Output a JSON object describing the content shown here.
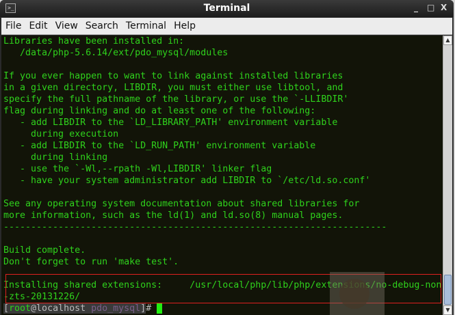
{
  "window": {
    "title": "Terminal",
    "minimize": "_",
    "maximize": "□",
    "close": "X"
  },
  "menu": [
    "File",
    "Edit",
    "View",
    "Search",
    "Terminal",
    "Help"
  ],
  "output": [
    "Libraries have been installed in:",
    "   /data/php-5.6.14/ext/pdo_mysql/modules",
    "",
    "If you ever happen to want to link against installed libraries",
    "in a given directory, LIBDIR, you must either use libtool, and",
    "specify the full pathname of the library, or use the `-LLIBDIR'",
    "flag during linking and do at least one of the following:",
    "   - add LIBDIR to the `LD_LIBRARY_PATH' environment variable",
    "     during execution",
    "   - add LIBDIR to the `LD_RUN_PATH' environment variable",
    "     during linking",
    "   - use the `-Wl,--rpath -Wl,LIBDIR' linker flag",
    "   - have your system administrator add LIBDIR to `/etc/ld.so.conf'",
    "",
    "See any operating system documentation about shared libraries for",
    "more information, such as the ld(1) and ld.so(8) manual pages.",
    "----------------------------------------------------------------------",
    "",
    "Build complete.",
    "Don't forget to run 'make test'.",
    "",
    "Installing shared extensions:     /usr/local/php/lib/php/extensions/no-debug-non",
    "-zts-20131226/"
  ],
  "prompt": {
    "open": "[",
    "user": "root",
    "host": "@localhost ",
    "dir": "pdo_mysql",
    "close": "]",
    "symbol": "# "
  }
}
